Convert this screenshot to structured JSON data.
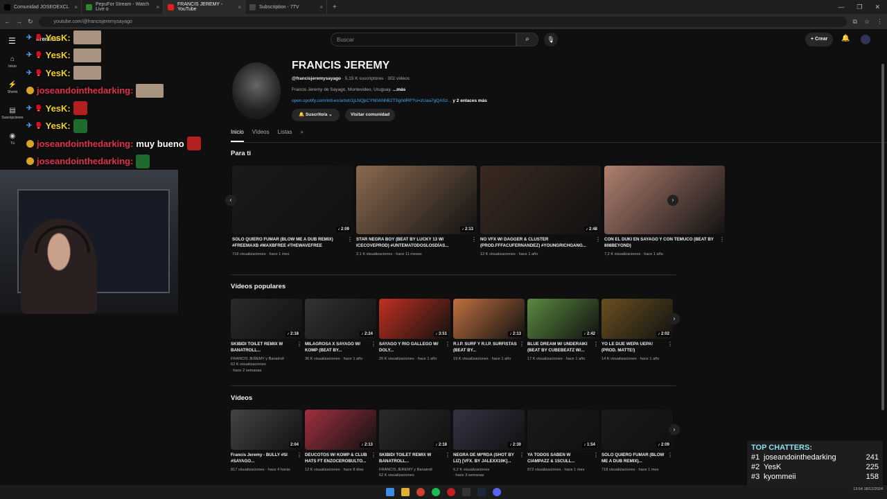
{
  "browser": {
    "tabs": [
      {
        "label": "Comunidad JOSEOEXCL",
        "color": "#000"
      },
      {
        "label": "PepuFor Stream - Watch Live o",
        "color": "#2a8a2a"
      },
      {
        "label": "FRANCIS JEREMY - YouTube",
        "color": "#e02020"
      },
      {
        "label": "Subscription - 7TV",
        "color": "#444"
      }
    ],
    "new_tab": "+",
    "url": "youtube.com/@francisjeremysayago"
  },
  "yt": {
    "logo": "Premium",
    "search_placeholder": "Buscar",
    "create": "+ Crear",
    "rail": [
      {
        "icon": "⌂",
        "label": "Inicio"
      },
      {
        "icon": "⚡",
        "label": "Shorts"
      },
      {
        "icon": "▤",
        "label": "Suscripciones"
      },
      {
        "icon": "◉",
        "label": "Tú"
      }
    ]
  },
  "channel": {
    "name": "FRANCIS JEREMY",
    "handle": "@francisjeremysayago",
    "stats": " · 5,15 K suscriptores · 302 vídeos",
    "bio": "Francis Jeremy de Sayago, Montevideo, Uruguay. ",
    "bio_more": "...más",
    "link": "open.spotify.com/intl-es/artist/1jLNQpCYN0ANhB2TSg0dRP?si=zUaa7gQASz...",
    "link_more": " y 2 enlaces más",
    "subscribed": "🔔 Suscrito/a ⌄",
    "community": "Visitar comunidad",
    "tabs": [
      "Inicio",
      "Vídeos",
      "Listas"
    ]
  },
  "sections": {
    "para_ti": {
      "title": "Para ti",
      "items": [
        {
          "title": "SOLO QUIERO FUMAR (BLOW ME A DUB REMIX) #FREEMAXB #MAXBFREE #THEWAVEFREE",
          "meta": "718 visualizaciones · hace 1 mes",
          "dur": "♪ 2:09",
          "c": "#1a1a1a"
        },
        {
          "title": "STAR NEGRA BOY (BEAT BY LUCKY 13 W/ ICECOVEPROD) #UNTEMATODOSLOSDÍAS...",
          "meta": "2,1 K visualizaciones · hace 11 meses",
          "dur": "♪ 2:13",
          "c": "#8a6a50"
        },
        {
          "title": "NO VFX W/ DAGGER & CLÚSTER (PROD.FFFACUFERNANDEZ) #YOUNGRICHGANG...",
          "meta": "12 K visualizaciones · hace 1 año",
          "dur": "♪ 2:48",
          "c": "#3a2a20"
        },
        {
          "title": "CON EL DUKI EN SAYAGO Y CON TEMUCO (BEAT BY 808BEYOND)",
          "meta": "7,2 K visualizaciones · hace 1 año",
          "dur": "",
          "c": "#b08070"
        }
      ]
    },
    "populares": {
      "title": "Vídeos populares",
      "items": [
        {
          "title": "SKIBIDI TOILET REMIX W BANATROLL...",
          "meta": "FRANCIS JEREMY y Banatroll\n62 K visualizaciones\n· hace 2 semanas",
          "dur": "♪ 2:18",
          "c": "#2a2a2a"
        },
        {
          "title": "MILAGROSA X SAYAGO W/ KOMP (BEAT BY...",
          "meta": "36 K visualizaciones · hace 1 año",
          "dur": "♪ 2:24",
          "c": "#333"
        },
        {
          "title": "SAYAGO Y RIO GALLEGO W/ DOLY...",
          "meta": "26 K visualizaciones · hace 1 año",
          "dur": "♪ 3:51",
          "c": "#c03020"
        },
        {
          "title": "R.I.P. SURF Y R.I.P. SURFISTAS (BEAT BY...",
          "meta": "19 K visualizaciones · hace 1 año",
          "dur": "♪ 2:13",
          "c": "#c07040"
        },
        {
          "title": "BLUE DREAM W/ UNDERAIKI (BEAT BY CUBEBEATZ W/...",
          "meta": "17 K visualizaciones · hace 1 año",
          "dur": "♪ 2:42",
          "c": "#5a8a40"
        },
        {
          "title": "YO LE DIJE WEPA UEPA! (PROD. MATTE!)",
          "meta": "14 K visualizaciones · hace 1 año",
          "dur": "♪ 2:02",
          "c": "#6a5020"
        }
      ]
    },
    "videos": {
      "title": "Vídeos",
      "items": [
        {
          "title": "Francis Jeremy - BULLY #SI #SAYAGO...",
          "meta": "817 visualizaciones · hace 4 horas",
          "dur": "2:04",
          "c": "#444"
        },
        {
          "title": "DEUCOTOS W/ KOMP & CLUB HATS FT ENZOCEROBULTO...",
          "meta": "12 K visualizaciones · hace 8 días",
          "dur": "♪ 2:13",
          "c": "#a03040"
        },
        {
          "title": "SKIBIDI TOILET REMIX W BANATROLL...",
          "meta": "FRANCIS JEREMY y Banatroll\n62 K visualizaciones",
          "dur": "♪ 2:18",
          "c": "#2a2a2a"
        },
        {
          "title": "NEGRA DE MI*RDA (SHOT BY LIZ) [VFX. BY JALEXX19K]...",
          "meta": "6,2 K visualizaciones\n· hace 3 semanas",
          "dur": "♪ 2:30",
          "c": "#334"
        },
        {
          "title": "YA TODOS SABEN W CIAMPAZZ & 1SCULL...",
          "meta": "972 visualizaciones · hace 1 mes",
          "dur": "♪ 1:54",
          "c": "#1a1a1a"
        },
        {
          "title": "SOLO QUIERO FUMAR (BLOW ME A DUB REMIX)...",
          "meta": "718 visualizaciones · hace 1 mes",
          "dur": "♪ 2:09",
          "c": "#1a1a1a"
        }
      ]
    }
  },
  "chat": [
    {
      "user": "YesK",
      "kind": "yes",
      "emote": "em"
    },
    {
      "user": "YesK",
      "kind": "yes",
      "emote": "em"
    },
    {
      "user": "YesK",
      "kind": "yes",
      "emote": "em"
    },
    {
      "user": "joseandointhedarking",
      "kind": "jose",
      "emote": "em",
      "text": ""
    },
    {
      "user": "YesK",
      "kind": "yes",
      "emote": "er"
    },
    {
      "user": "YesK",
      "kind": "yes",
      "emote": "eg"
    },
    {
      "user": "joseandointhedarking",
      "kind": "jose",
      "text": "muy bueno",
      "emote": "er"
    },
    {
      "user": "joseandointhedarking",
      "kind": "jose",
      "emote": "eg",
      "text": ""
    }
  ],
  "top_chatters": {
    "title": "TOP CHATTERS:",
    "rows": [
      {
        "rank": "#1",
        "name": "joseandointhedarking",
        "count": "241"
      },
      {
        "rank": "#2",
        "name": "YesK",
        "count": "225"
      },
      {
        "rank": "#3",
        "name": "kyommeii",
        "count": "158"
      }
    ]
  },
  "clock": {
    "lang": "ESP\nLAA",
    "time": "13:54\n18/12/2024"
  }
}
